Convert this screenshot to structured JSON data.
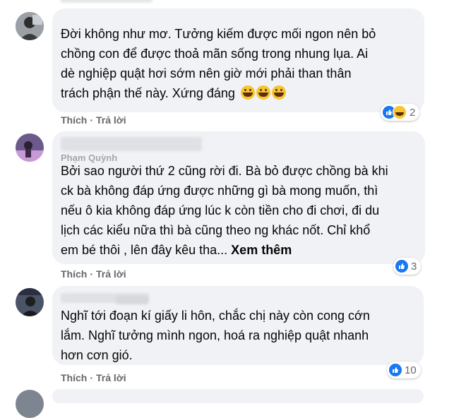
{
  "comments": [
    {
      "text_lines": [
        "Đời không như mơ. Tưởng kiếm được mối ngon nên bỏ",
        "chồng con để được thoả mãn sống trong nhung lụa. Ai",
        "dè nghiệp quật hơi sớm nên giờ mới phải than thân",
        "trách phận thế này. Xứng đáng"
      ],
      "like_label": "Thích",
      "reply_label": "Trả lời",
      "reaction_count": "2",
      "reaction_icons": [
        "like-icon",
        "haha-icon"
      ]
    },
    {
      "name_partial": "Phạm Quỳnh",
      "text_lines": [
        "Bởi sao người thứ 2 cũng rời đi. Bà bỏ được chồng bà khi",
        "ck bà không đáp ứng được những gì bà mong muốn, thì",
        "nếu ô kia không đáp ứng lúc k còn tiền cho đi chơi, đi du",
        "lịch các kiểu nữa thì bà cũng theo ng khác nốt. Chỉ khổ",
        "em bé thôi , lên đây kêu tha..."
      ],
      "see_more": "Xem thêm",
      "like_label": "Thích",
      "reply_label": "Trả lời",
      "reaction_count": "3",
      "reaction_icons": [
        "like-icon"
      ]
    },
    {
      "text_lines": [
        "Nghĩ tới đoạn kí giấy li hôn, chắc chị này còn cong cớn",
        "lắm. Nghĩ tưởng mình ngon, hoá ra nghiệp quật nhanh",
        "hơn cơn gió."
      ],
      "like_label": "Thích",
      "reply_label": "Trả lời",
      "reaction_count": "10",
      "reaction_icons": [
        "like-icon"
      ]
    }
  ],
  "colors": {
    "bubble": "#f0f2f5",
    "secondary_text": "#65676b",
    "like_blue": "#1877f2",
    "haha_yellow": "#f7c531"
  }
}
